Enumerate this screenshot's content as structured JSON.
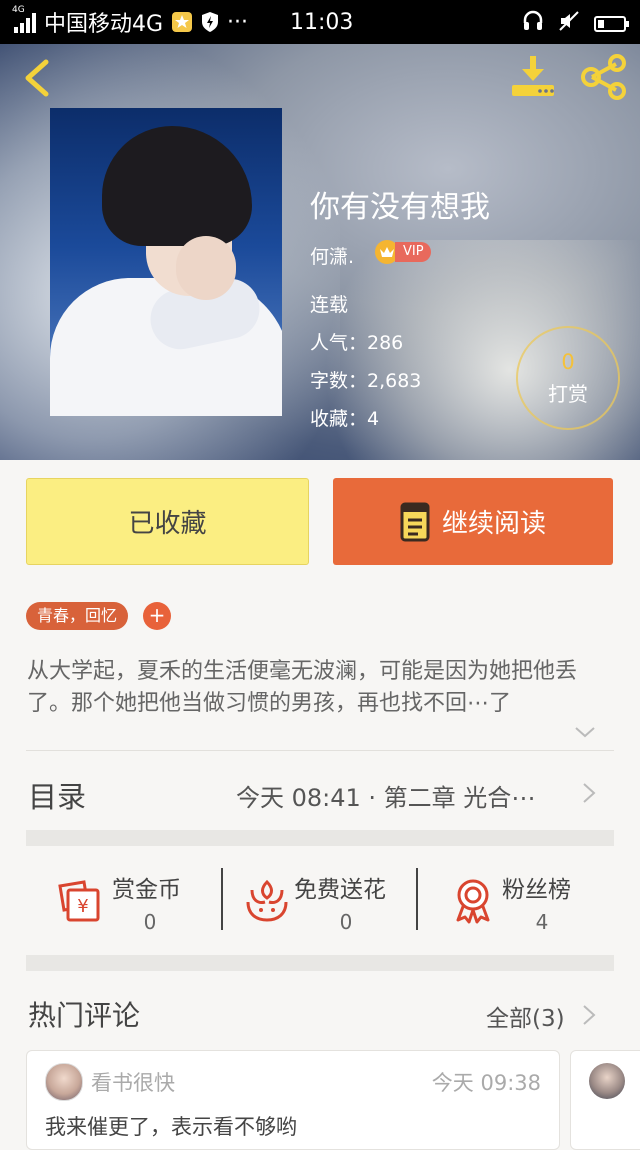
{
  "status_bar": {
    "network_tag": "4G",
    "carrier": "中国移动4G",
    "time": "11:03",
    "ellipsis": "···"
  },
  "book": {
    "title": "你有没有想我",
    "author": "何潇.",
    "vip_label": "VIP",
    "status": "连载",
    "popularity": "人气：286",
    "word_count": "字数：2,683",
    "favorites": "收藏：4",
    "reward_count": "0",
    "reward_label": "打赏"
  },
  "actions": {
    "favorited_label": "已收藏",
    "continue_label": "继续阅读"
  },
  "tags": {
    "label": "青春，回忆",
    "add_label": "+"
  },
  "description": "从大学起，夏禾的生活便毫无波澜，可能是因为她把他丢了。那个她把他当做习惯的男孩，再也找不回⋯了",
  "toc": {
    "title": "目录",
    "latest": "今天 08:41 · 第二章 光合⋯"
  },
  "stats": [
    {
      "label": "赏金币",
      "value": "0",
      "icon": "red-envelope-icon"
    },
    {
      "label": "免费送花",
      "value": "0",
      "icon": "flower-icon"
    },
    {
      "label": "粉丝榜",
      "value": "4",
      "icon": "medal-icon"
    }
  ],
  "comments": {
    "title": "热门评论",
    "all_label": "全部(3)",
    "items": [
      {
        "user": "看书很快",
        "time": "今天 09:38",
        "text": "我来催更了，表示看不够哟"
      }
    ]
  },
  "colors": {
    "accent_orange": "#e86a3a",
    "favorite_yellow": "#fbee82",
    "icon_red": "#d9452f",
    "hero_icon_yellow": "#f4d23a"
  }
}
